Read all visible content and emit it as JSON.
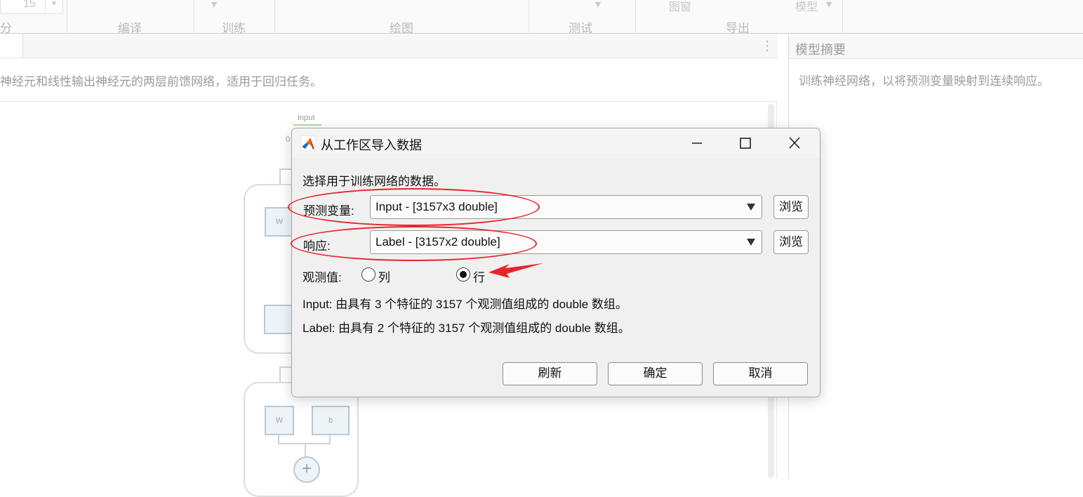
{
  "toolstrip": {
    "spinner_value": "15",
    "sections": [
      "分",
      "编译",
      "训练",
      "绘图",
      "测试",
      "导出"
    ],
    "ghost_labels": [
      "图窗",
      "模型"
    ]
  },
  "document": {
    "description": "神经元和线性输出神经元的两层前馈网络，适用于回归任务。",
    "input_node_label": "Input",
    "zero_label": "0",
    "weight_labels": [
      "W",
      "W",
      "b"
    ],
    "plus_symbol": "+"
  },
  "right_panel": {
    "title": "模型摘要",
    "text": "训练神经网络，以将预测变量映射到连续响应。"
  },
  "dialog": {
    "title": "从工作区导入数据",
    "instruction": "选择用于训练网络的数据。",
    "predictor_label": "预测变量:",
    "predictor_value": "Input - [3157x3 double]",
    "response_label": "响应:",
    "response_value": "Label - [3157x2 double]",
    "browse_label": "浏览",
    "observations_label": "观测值:",
    "option_column": "列",
    "option_row": "行",
    "selected_option": "行",
    "input_info": "Input: 由具有 3 个特征的 3157 个观测值组成的 double 数组。",
    "label_info": "Label: 由具有 2 个特征的 3157 个观测值组成的 double 数组。",
    "refresh_label": "刷新",
    "ok_label": "确定",
    "cancel_label": "取消"
  },
  "annotations": {
    "color": "#e8242b"
  }
}
